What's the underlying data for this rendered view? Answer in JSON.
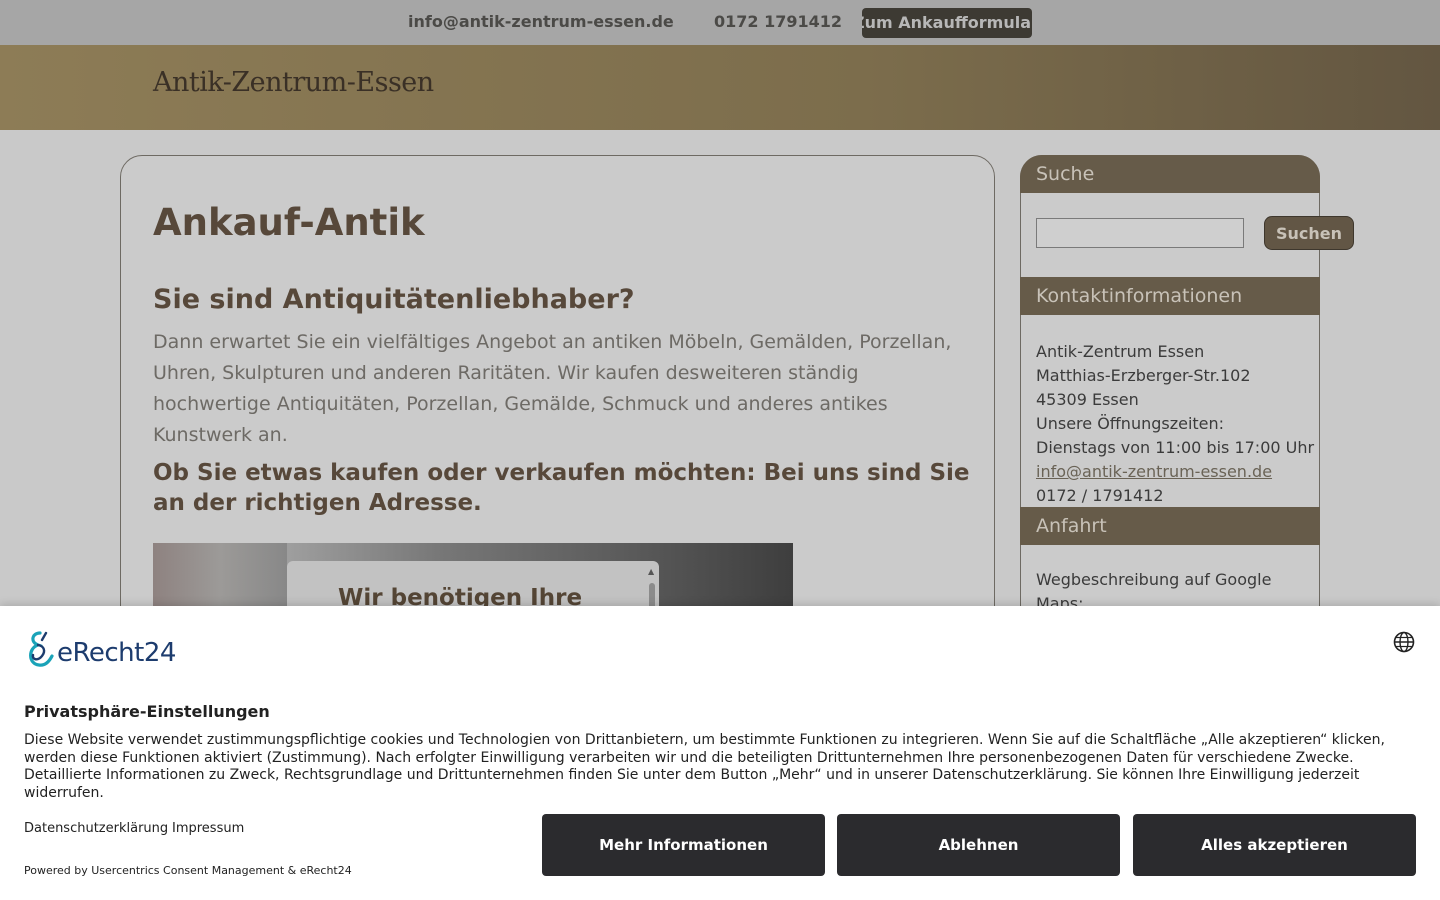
{
  "topbar": {
    "email": "info@antik-zentrum-essen.de",
    "phone": "0172 1791412",
    "form_button": "Zum Ankaufformular"
  },
  "header": {
    "logo": "Antik-Zentrum-Essen"
  },
  "main": {
    "title": "Ankauf-Antik",
    "subheading": "Sie sind Antiquitätenliebhaber?",
    "intro": "Dann erwartet Sie ein vielfältiges Angebot an antiken Möbeln, Gemälden, Porzellan, Uhren, Skulpturen und anderen Raritäten. Wir kaufen desweiteren ständig hochwertige Antiquitäten, Porzellan, Gemälde, Schmuck und anderes antikes Kunstwerk an.",
    "slogan": "Ob Sie etwas kaufen oder verkaufen möchten: Bei uns sind Sie an der richtigen Adresse.",
    "embedded_consent_title": "Wir benötigen Ihre"
  },
  "sidebar": {
    "search_heading": "Suche",
    "search_button": "Suchen",
    "search_value": "",
    "contact_heading": "Kontaktinformationen",
    "contact_lines": [
      "Antik-Zentrum Essen",
      "Matthias-Erzberger-Str.102",
      "45309 Essen",
      "Unsere Öffnungszeiten:",
      "Dienstags von 11:00 bis 17:00 Uhr"
    ],
    "contact_email": "info@antik-zentrum-essen.de",
    "contact_phone": "0172 / 1791412",
    "route_heading": "Anfahrt",
    "route_text": "Wegbeschreibung auf Google Maps:"
  },
  "cookie_banner": {
    "brand": "eRecht24",
    "title": "Privatsphäre-Einstellungen",
    "text": "Diese Website verwendet zustimmungspflichtige cookies und Technologien von Drittanbietern, um bestimmte Funktionen zu integrieren. Wenn Sie auf die Schaltfläche „Alle akzeptieren“ klicken, werden diese Funktionen aktiviert (Zustimmung). Nach erfolgter Einwilligung verarbeiten wir und die beteiligten Drittunternehmen Ihre personenbezogenen Daten für verschiedene Zwecke. Detaillierte Informationen zu Zweck, Rechtsgrundlage und Drittunternehmen finden Sie unter dem Button „Mehr“ und in unserer Datenschutzerklärung. Sie können Ihre Einwilligung jederzeit widerrufen.",
    "link_privacy": "Datenschutzerklärung",
    "link_imprint": "Impressum",
    "powered_by": "Powered by Usercentrics Consent Management & eRecht24",
    "btn_more": "Mehr Informationen",
    "btn_decline": "Ablehnen",
    "btn_accept": "Alles akzeptieren"
  },
  "icons": {
    "brand": "erecht24-logo-icon",
    "language": "globe-icon"
  },
  "colors": {
    "accent_brown": "#665b49",
    "header_gold": "#8d7c56",
    "banner_button": "#2b2b2e",
    "brand_teal": "#1aa3b8"
  }
}
